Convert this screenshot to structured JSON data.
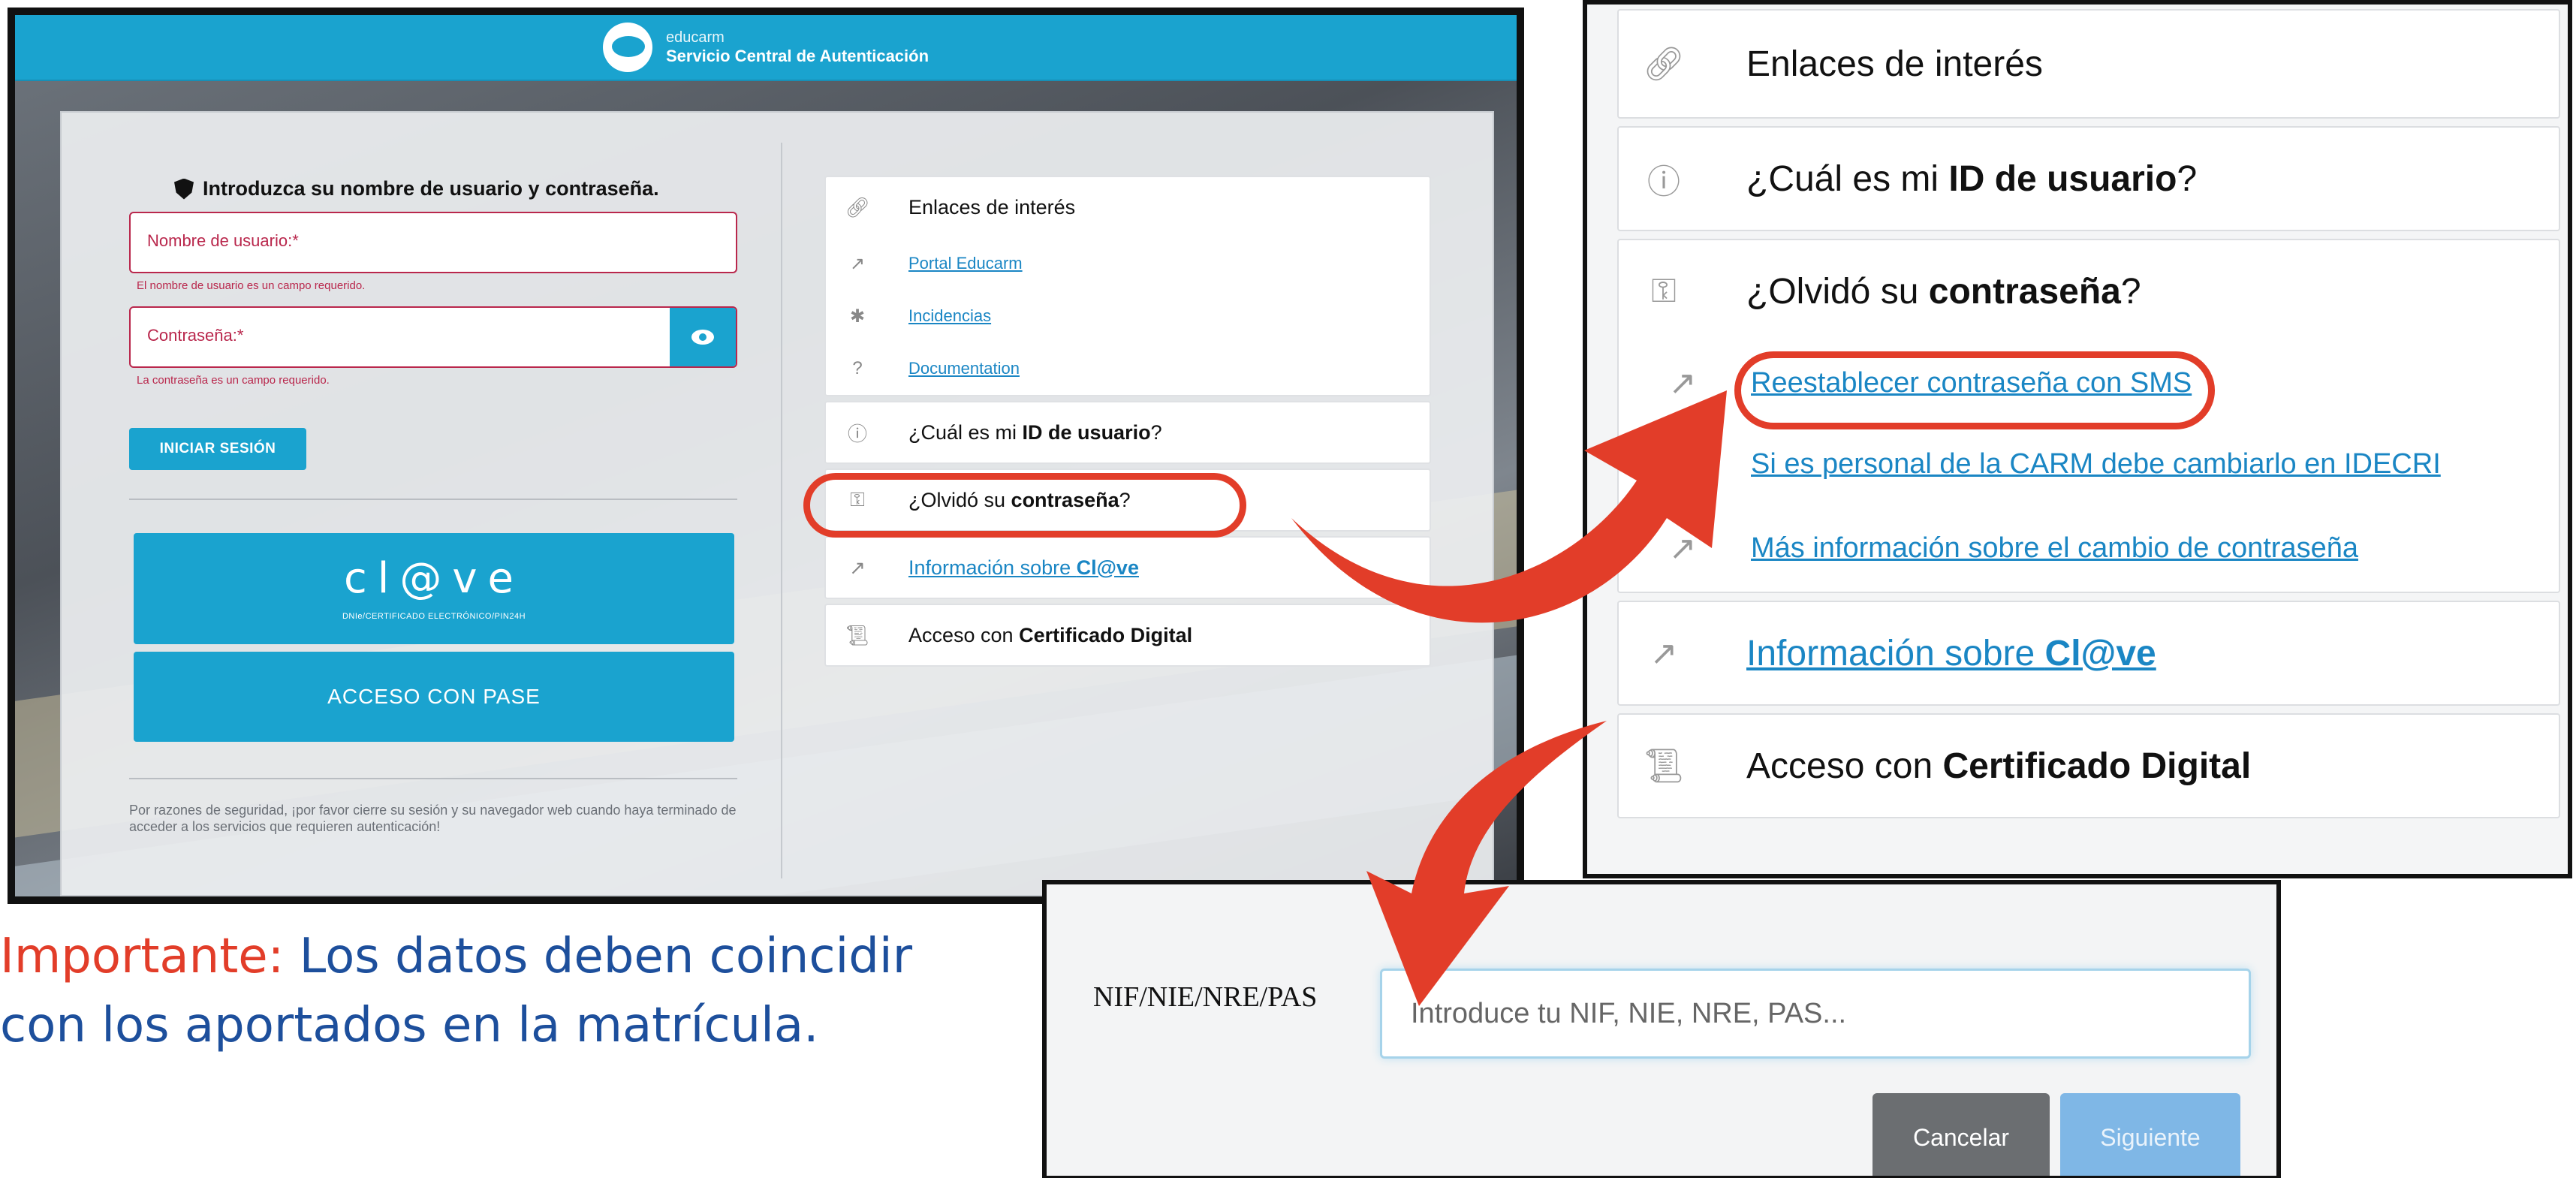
{
  "colors": {
    "accent": "#1aa3cf",
    "error": "#b9274c",
    "highlight": "#e23d29",
    "link": "#1a86c4",
    "note_blue": "#1d4f9c"
  },
  "header": {
    "brand": "educarm",
    "subtitle": "Servicio Central de Autenticación",
    "logo_icon": "educarm-logo-icon"
  },
  "login": {
    "heading": "Introduzca su nombre de usuario y contraseña.",
    "heading_icon": "shield-icon",
    "username_label": "Nombre de usuario:*",
    "username_error": "El nombre de usuario es un campo requerido.",
    "password_label": "Contraseña:*",
    "password_error": "La contraseña es un campo requerido.",
    "toggle_icon": "eye-icon",
    "submit": "INICIAR SESIÓN",
    "clave_logo": "cl@ve",
    "clave_sub": "DNIe/CERTIFICADO ELECTRÓNICO/PIN24H",
    "pase_button": "ACCESO CON PASE",
    "security_note": "Por razones de seguridad, ¡por favor cierre su sesión y su navegador web cuando haya terminado de acceder a los servicios que requieren autenticación!"
  },
  "links": {
    "title": "Enlaces de interés",
    "items": [
      "Portal Educarm",
      "Incidencias",
      "Documentation"
    ],
    "id_prefix": "¿Cuál es mi ",
    "id_bold": "ID de usuario",
    "id_suffix": "?",
    "pwd_prefix": "¿Olvidó su ",
    "pwd_bold": "contraseña",
    "pwd_suffix": "?",
    "clave_prefix": "Información sobre ",
    "clave_bold": "Cl@ve",
    "cert_prefix": "Acceso con ",
    "cert_bold": "Certificado Digital"
  },
  "expanded": {
    "reset_links": [
      "Reestablecer contraseña con SMS",
      "Si es personal de la CARM debe cambiarlo en IDECRI",
      "Más información sobre el cambio de contraseña"
    ]
  },
  "nif_form": {
    "label": "NIF/NIE/NRE/PAS",
    "placeholder": "Introduce tu NIF, NIE, NRE, PAS...",
    "cancel": "Cancelar",
    "next": "Siguiente"
  },
  "note": {
    "important": "Importante:",
    "text": "Los datos deben coincidir con los aportados en la matrícula."
  }
}
